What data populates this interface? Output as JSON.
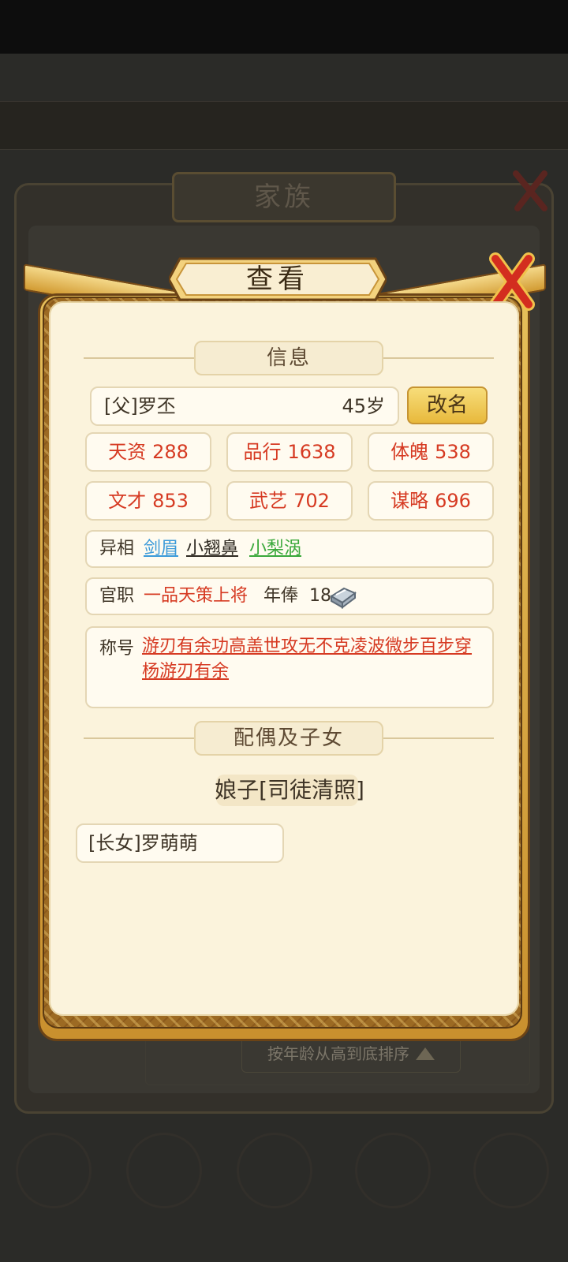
{
  "background": {
    "sort_label": "按年龄从高到底排序",
    "family_title": "家族"
  },
  "dialog": {
    "title": "查看",
    "info_section": "信息",
    "person": {
      "name": "[父]罗丕",
      "age": "45岁"
    },
    "rename_label": "改名",
    "stats": [
      {
        "label": "天资",
        "value": "288"
      },
      {
        "label": "品行",
        "value": "1638"
      },
      {
        "label": "体魄",
        "value": "538"
      },
      {
        "label": "文才",
        "value": "853"
      },
      {
        "label": "武艺",
        "value": "702"
      },
      {
        "label": "谋略",
        "value": "696"
      }
    ],
    "features": {
      "label": "异相",
      "items": [
        {
          "text": "剑眉",
          "color": "#3b9ad9"
        },
        {
          "text": "小翘鼻",
          "color": "#2f2a22"
        },
        {
          "text": "小梨涡",
          "color": "#3aa83a"
        }
      ]
    },
    "office": {
      "label": "官职",
      "rank": "一品天策上将",
      "salary_label": "年俸",
      "salary_value": "18"
    },
    "titles": {
      "label": "称号",
      "text": "游刃有余功高盖世攻无不克凌波微步百步穿杨游刃有余"
    },
    "family_section": "配偶及子女",
    "spouse": "娘子[司徒清照]",
    "children": [
      "[长女]罗萌萌"
    ]
  }
}
